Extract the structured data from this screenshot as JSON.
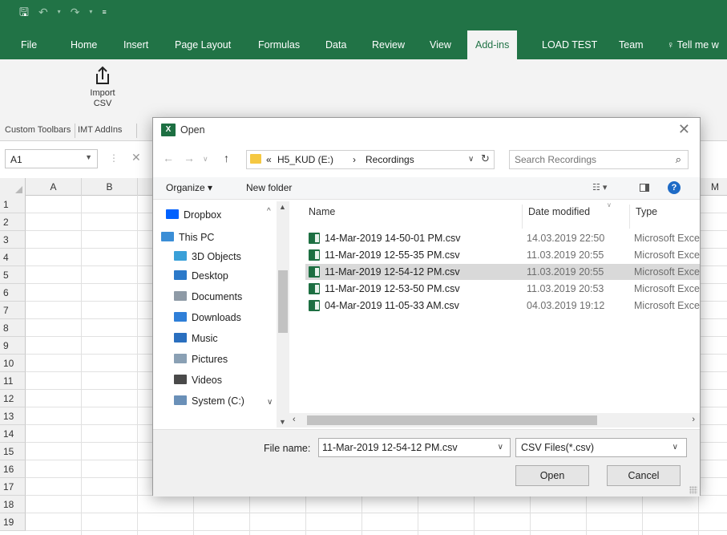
{
  "excel": {
    "tabs": [
      "File",
      "Home",
      "Insert",
      "Page Layout",
      "Formulas",
      "Data",
      "Review",
      "View",
      "Add-ins",
      "LOAD TEST",
      "Team",
      "Tell me w"
    ],
    "active_tab": "Add-ins",
    "import_button": {
      "line1": "Import",
      "line2": "CSV"
    },
    "group_labels": [
      "Custom Toolbars",
      "IMT AddIns"
    ],
    "name_box": "A1",
    "columns": [
      "A",
      "B",
      "M"
    ],
    "rows": [
      "1",
      "2",
      "3",
      "4",
      "5",
      "6",
      "7",
      "8",
      "9",
      "10",
      "11",
      "12",
      "13",
      "14",
      "15",
      "16",
      "17",
      "18",
      "19"
    ]
  },
  "dialog": {
    "icon_text": "X",
    "title": "Open",
    "address": {
      "prefix": "«",
      "drive": "H5_KUD (E:)",
      "separator": "›",
      "folder": "Recordings"
    },
    "search_placeholder": "Search Recordings",
    "toolbar": {
      "organize": "Organize ▾",
      "new_folder": "New folder",
      "help": "?"
    },
    "nav_items": [
      {
        "label": "Dropbox",
        "icon": "dropbox-icon",
        "color": "#0061fe"
      },
      {
        "label": "This PC",
        "icon": "computer-icon",
        "color": "#3b8ed6"
      },
      {
        "label": "3D Objects",
        "icon": "cube-icon",
        "color": "#3aa0d8"
      },
      {
        "label": "Desktop",
        "icon": "desktop-icon",
        "color": "#2b79c9"
      },
      {
        "label": "Documents",
        "icon": "document-icon",
        "color": "#8e9aa6"
      },
      {
        "label": "Downloads",
        "icon": "download-icon",
        "color": "#2f7fd8"
      },
      {
        "label": "Music",
        "icon": "music-icon",
        "color": "#2a6fbf"
      },
      {
        "label": "Pictures",
        "icon": "pictures-icon",
        "color": "#8aa0b4"
      },
      {
        "label": "Videos",
        "icon": "video-icon",
        "color": "#4a4a4a"
      },
      {
        "label": "System (C:)",
        "icon": "drive-icon",
        "color": "#6a90b8"
      }
    ],
    "columns": {
      "name": "Name",
      "date": "Date modified",
      "type": "Type"
    },
    "files": [
      {
        "name": "14-Mar-2019 14-50-01 PM.csv",
        "date": "14.03.2019 22:50",
        "type": "Microsoft Excel"
      },
      {
        "name": "11-Mar-2019 12-55-35 PM.csv",
        "date": "11.03.2019 20:55",
        "type": "Microsoft Excel"
      },
      {
        "name": "11-Mar-2019 12-54-12 PM.csv",
        "date": "11.03.2019 20:55",
        "type": "Microsoft Excel"
      },
      {
        "name": "11-Mar-2019 12-53-50 PM.csv",
        "date": "11.03.2019 20:53",
        "type": "Microsoft Excel"
      },
      {
        "name": "04-Mar-2019 11-05-33 AM.csv",
        "date": "04.03.2019 19:12",
        "type": "Microsoft Excel"
      }
    ],
    "selected_file_index": 2,
    "file_name_label": "File name:",
    "file_name_value": "11-Mar-2019 12-54-12 PM.csv",
    "file_type_value": "CSV Files(*.csv)",
    "open_button": "Open",
    "cancel_button": "Cancel"
  },
  "colors": {
    "excel_green": "#217346",
    "selection": "#d9d9d9",
    "help_blue": "#1e6bc6"
  }
}
